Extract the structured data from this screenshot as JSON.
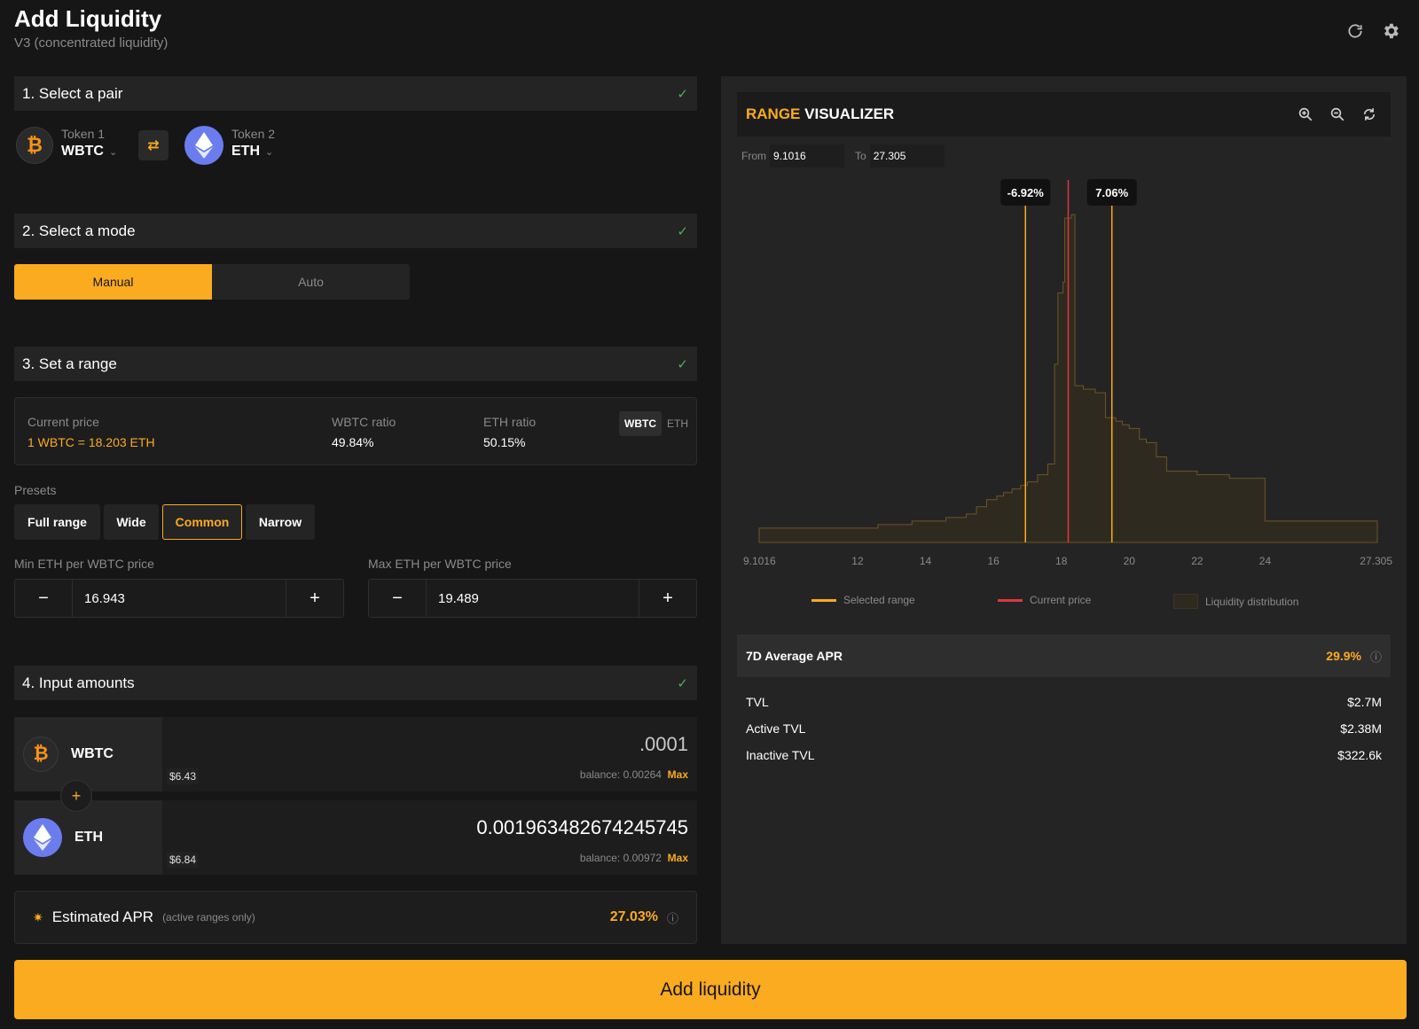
{
  "header": {
    "title": "Add Liquidity",
    "subtitle": "V3 (concentrated liquidity)",
    "refresh_icon": "refresh-icon",
    "settings_icon": "gear-icon"
  },
  "sections": {
    "s1": "1. Select a pair",
    "s2": "2. Select a mode",
    "s3": "3. Set a range",
    "s4": "4. Input amounts"
  },
  "pair": {
    "token1_label": "Token 1",
    "token1_name": "WBTC",
    "token2_label": "Token 2",
    "token2_name": "ETH",
    "swap_icon": "swap-arrows-icon"
  },
  "mode": {
    "manual": "Manual",
    "auto": "Auto",
    "selected": "Manual"
  },
  "range": {
    "current_price_label": "Current price",
    "current_price_value": "1 WBTC = 18.203 ETH",
    "wbtc_ratio_label": "WBTC ratio",
    "wbtc_ratio_value": "49.84%",
    "eth_ratio_label": "ETH ratio",
    "eth_ratio_value": "50.15%",
    "toggle_wbtc": "WBTC",
    "toggle_eth": "ETH",
    "presets_label": "Presets",
    "presets": [
      "Full range",
      "Wide",
      "Common",
      "Narrow"
    ],
    "selected_preset": "Common",
    "min_label": "Min ETH per WBTC price",
    "min_value": "16.943",
    "max_label": "Max ETH per WBTC price",
    "max_value": "19.489",
    "minus": "−",
    "plus": "+"
  },
  "amounts": {
    "wbtc_name": "WBTC",
    "wbtc_usd": "$6.43",
    "wbtc_amount": ".0001",
    "wbtc_balance": "balance: 0.00264",
    "eth_name": "ETH",
    "eth_usd": "$6.84",
    "eth_amount": "0.001963482674245745",
    "eth_balance": "balance: 0.00972",
    "max_label": "Max",
    "plus": "+"
  },
  "estimated_apr": {
    "label": "Estimated APR",
    "note": "(active ranges only)",
    "value": "27.03%"
  },
  "add_button": "Add liquidity",
  "visualizer": {
    "title_accent": "RANGE",
    "title_rest": " VISUALIZER",
    "from_label": "From",
    "from_value": "9.1016",
    "to_label": "To",
    "to_value": "27.305",
    "zoom_in_icon": "zoom-in-icon",
    "zoom_out_icon": "zoom-out-icon",
    "reset_icon": "reset-icon",
    "legend": {
      "selected": "Selected range",
      "current": "Current price",
      "liquidity": "Liquidity distribution"
    },
    "colors": {
      "selected": "#fbab1f",
      "current": "#e0363e",
      "liquidity_fill": "#2f2a1f",
      "liquidity_stroke": "#6e5526"
    }
  },
  "chart_data": {
    "type": "area",
    "x_ticks": [
      "9.1016",
      "12",
      "14",
      "16",
      "18",
      "20",
      "22",
      "24",
      "27.305"
    ],
    "xlim": [
      9.1016,
      27.305
    ],
    "x": [
      9.1016,
      12.6,
      13.6,
      14.6,
      15.2,
      15.5,
      15.8,
      16.1,
      16.3,
      16.55,
      16.8,
      17.0,
      17.3,
      17.6,
      17.8,
      17.9,
      18.05,
      18.1,
      18.3,
      18.4,
      18.65,
      19.0,
      19.3,
      19.6,
      19.8,
      20.0,
      20.3,
      20.5,
      20.8,
      21.1,
      22.0,
      22.95,
      24.0,
      27.305
    ],
    "values": [
      4,
      5,
      6,
      7,
      8,
      10,
      12,
      13,
      14,
      15,
      16,
      17,
      19,
      22,
      50,
      70,
      73,
      91,
      92,
      44,
      43,
      42,
      35,
      34,
      33,
      32,
      29,
      28,
      24,
      20,
      19,
      18,
      6,
      5
    ],
    "selected_range": [
      16.943,
      19.489
    ],
    "selected_labels": [
      "-6.92%",
      "7.06%"
    ],
    "current_price": 18.203
  },
  "pool_stats": {
    "apr_label": "7D Average APR",
    "apr_value": "29.9%",
    "tvl_label": "TVL",
    "tvl_value": "$2.7M",
    "active_label": "Active TVL",
    "active_value": "$2.38M",
    "inactive_label": "Inactive TVL",
    "inactive_value": "$322.6k"
  }
}
